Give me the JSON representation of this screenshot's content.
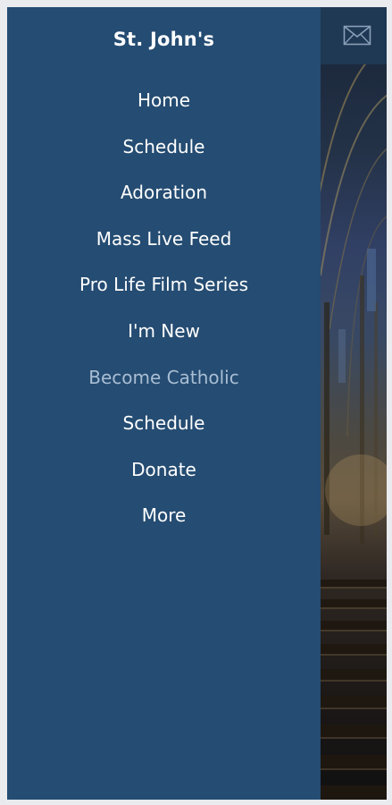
{
  "site": {
    "title": "St. John's"
  },
  "header": {
    "mail_icon": "envelope-icon"
  },
  "nav": {
    "items": [
      {
        "label": "Home",
        "active": false
      },
      {
        "label": "Schedule",
        "active": false
      },
      {
        "label": "Adoration",
        "active": false
      },
      {
        "label": "Mass Live Feed",
        "active": false
      },
      {
        "label": "Pro Life Film Series",
        "active": false
      },
      {
        "label": "I'm New",
        "active": false
      },
      {
        "label": "Become Catholic",
        "active": true
      },
      {
        "label": "Schedule",
        "active": false
      },
      {
        "label": "Donate",
        "active": false
      },
      {
        "label": "More",
        "active": false
      }
    ]
  },
  "colors": {
    "drawer_bg": "#254c72",
    "topbar_bg": "#1f3853",
    "active_text": "#a9bed4",
    "text": "#ffffff"
  }
}
